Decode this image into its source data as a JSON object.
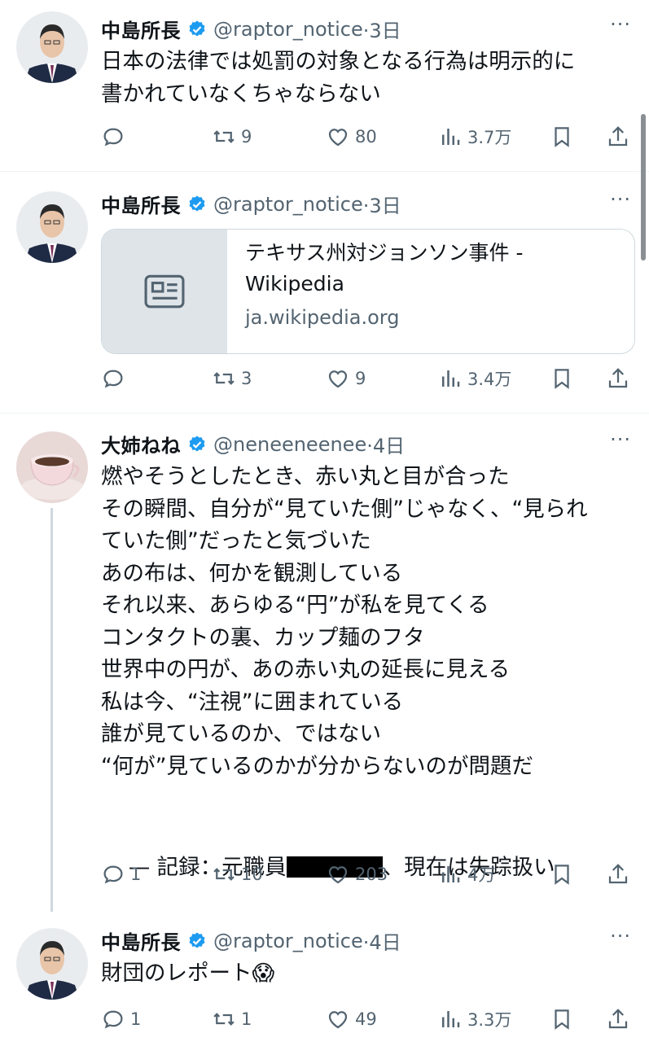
{
  "tweets": [
    {
      "name": "中島所長",
      "handle": "@raptor_notice",
      "time": "·3日",
      "more": "···",
      "text": "日本の法律では処罰の対象となる行為は明示的に\n書かれていなくちゃならない",
      "replies": "",
      "retweets": "9",
      "likes": "80",
      "views": "3.7万"
    },
    {
      "name": "中島所長",
      "handle": "@raptor_notice",
      "time": "·3日",
      "more": "···",
      "card": {
        "title": "テキサス州対ジョンソン事件 - Wikipedia",
        "domain": "ja.wikipedia.org"
      },
      "replies": "",
      "retweets": "3",
      "likes": "9",
      "views": "3.4万"
    },
    {
      "name": "大姉ねね",
      "handle": "@neneeneenee",
      "time": "·4日",
      "more": "···",
      "text": "燃やそうとしたとき、赤い丸と目が合った\nその瞬間、自分が“見ていた側”じゃなく、“見られ\nていた側”だったと気づいた\nあの布は、何かを観測している\nそれ以来、あらゆる“円”が私を見てくる\nコンタクトの裏、カップ麺のフタ\n世界中の円が、あの赤い丸の延長に見える\n私は今、“注視”に囲まれている\n誰が見ているのか、ではない\n“何が”見ているのかが分からないのが問題だ\n",
      "signature_prefix": "— 記録：元職員",
      "signature_suffix": "、現在は失踪扱い",
      "replies": "1",
      "retweets": "10",
      "likes": "203",
      "views": "4万"
    },
    {
      "name": "中島所長",
      "handle": "@raptor_notice",
      "time": "·4日",
      "more": "···",
      "text": "財団のレポート😱",
      "replies": "1",
      "retweets": "1",
      "likes": "49",
      "views": "3.3万"
    }
  ],
  "colors": {
    "verified": "#1d9bf0",
    "secondary_text": "#536471",
    "divider": "#eff3f4"
  }
}
